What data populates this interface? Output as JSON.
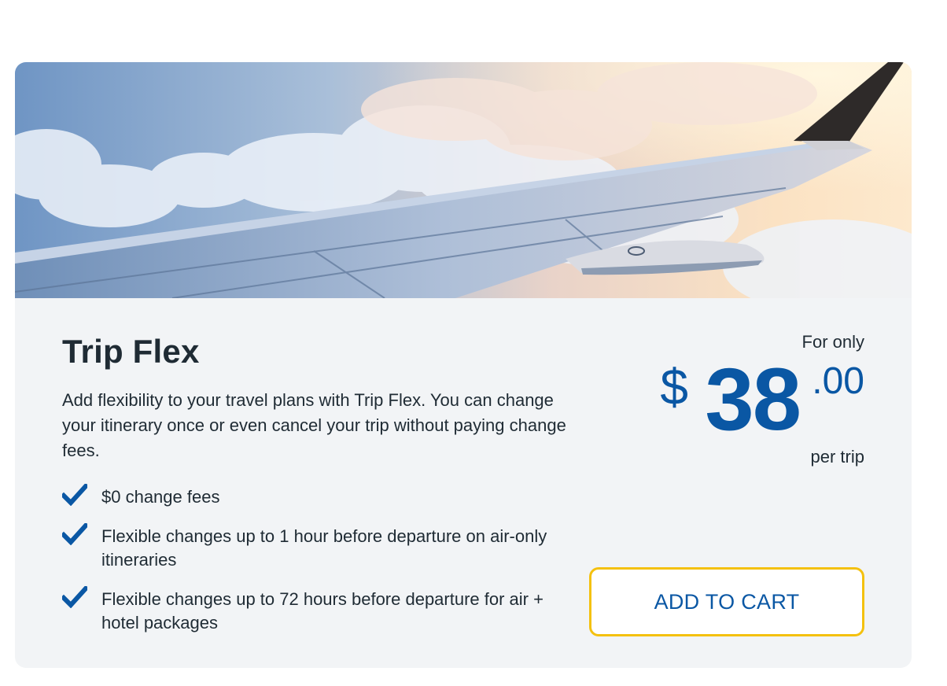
{
  "hero": {
    "image": "airplane-wing-above-clouds"
  },
  "product": {
    "title": "Trip Flex",
    "description": "Add flexibility to your travel plans with Trip Flex. You can change your itinerary once or even cancel your trip without paying change fees.",
    "features": [
      {
        "icon": "check-icon",
        "text": "$0 change fees"
      },
      {
        "icon": "check-icon",
        "text": "Flexible changes up to 1 hour before departure on air-only itineraries"
      },
      {
        "icon": "check-icon",
        "text": "Flexible changes up to 72 hours before departure for air + hotel packages"
      }
    ]
  },
  "price": {
    "prefix": "For only",
    "currency": "$",
    "whole": "38",
    "cents": ".00",
    "suffix": "per trip"
  },
  "cta": {
    "label": "ADD TO CART"
  },
  "colors": {
    "accent_blue": "#0a57a4",
    "button_border": "#f4c10f",
    "card_background": "#f2f4f6",
    "text_dark": "#1f2b34"
  }
}
